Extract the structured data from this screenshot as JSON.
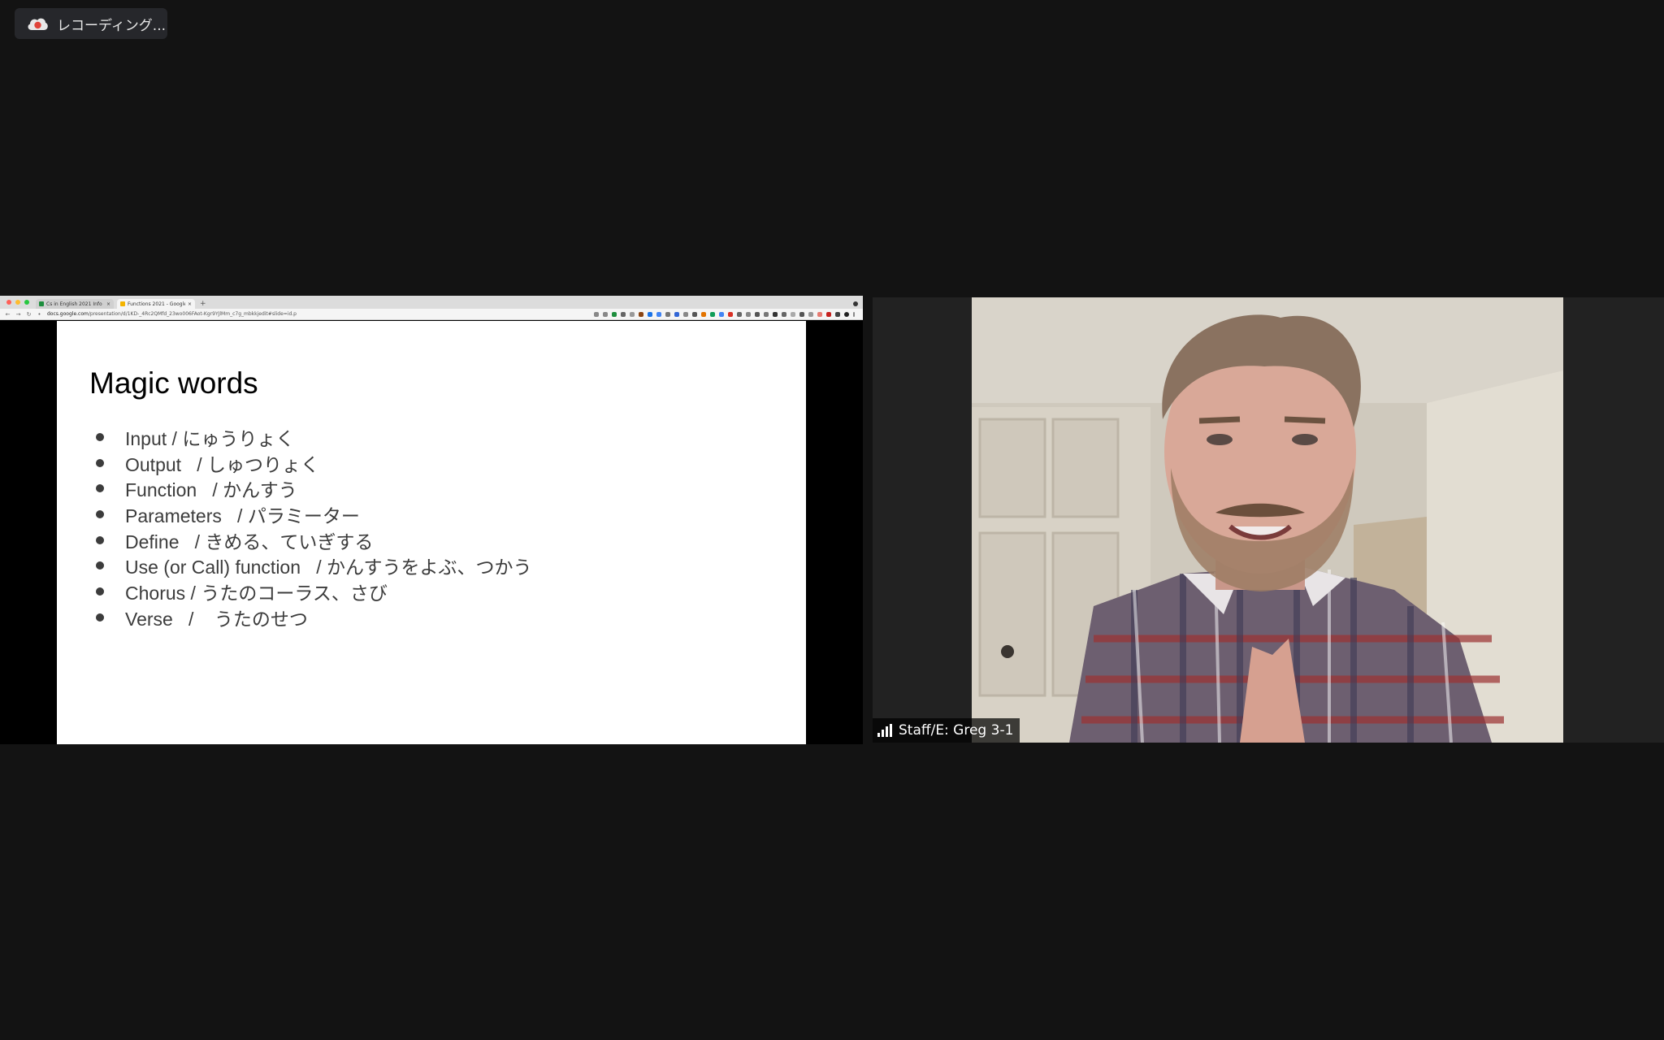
{
  "recording": {
    "label": "レコーディング...",
    "icon": "cloud-recording-icon"
  },
  "browser": {
    "tabs": [
      {
        "label": "Cs in English 2021 Info - Goo...",
        "active": false,
        "icon_color": "#1e8e3e"
      },
      {
        "label": "Functions 2021 - Google Slid...",
        "active": true,
        "icon_color": "#f4b400"
      }
    ],
    "new_tab_label": "+",
    "url_host": "docs.google.com",
    "url_path": "/presentation/d/1KD-_4Rc2QMfd_23wo006FAot-Kgr9YJlMm_c7g_mbkkjedit#slide=id.p"
  },
  "slide": {
    "title": "Magic words",
    "bullets": [
      "Input / にゅうりょく",
      "Output   / しゅつりょく",
      "Function   / かんすう",
      "Parameters   / パラミーター",
      "Define   / きめる、ていぎする",
      "Use (or Call) function   / かんすうをよぶ、つかう",
      "Chorus / うたのコーラス、さび",
      "Verse   /    うたのせつ"
    ]
  },
  "participant": {
    "name": "Staff/E: Greg 3-1"
  },
  "colors": {
    "background": "#131313",
    "record_red": "#e0443a"
  }
}
